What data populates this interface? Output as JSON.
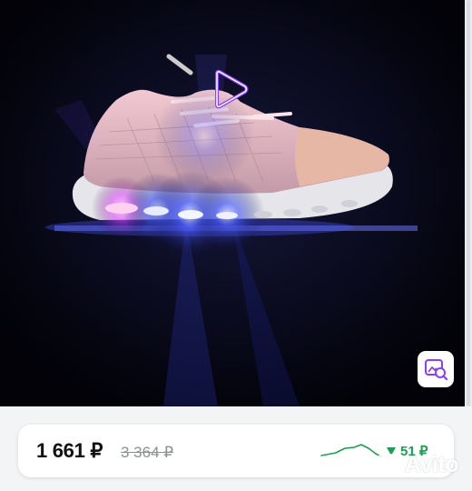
{
  "listing": {
    "photo": {
      "subject": "sneaker-with-led-sole",
      "background": "#000000"
    },
    "play_icon": "play-icon",
    "image_search_icon": "image-search-icon"
  },
  "price_card": {
    "price": "1 661 ₽",
    "old_price": "3 364 ₽",
    "trend_icon": "price-history-sparkline",
    "drop_amount": "51 ₽",
    "drop_color": "#1e9e55"
  },
  "watermark": {
    "brand": "Avito"
  },
  "colors": {
    "accent": "#8a3ffc",
    "price_drop": "#1e9e55"
  }
}
